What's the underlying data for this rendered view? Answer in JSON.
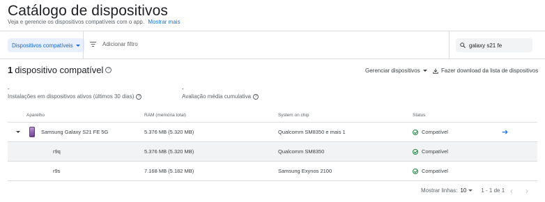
{
  "header": {
    "title": "Catálogo de dispositivos",
    "subtitle": "Veja e gerencie os dispositivos compatíveis com o app.",
    "learn_more": "Mostrar mais"
  },
  "filters": {
    "chip_label": "Dispositivos compatíveis",
    "add_filter": "Adicionar filtro",
    "search_value": "galaxy s21 fe"
  },
  "summary": {
    "count": "1",
    "count_label": "dispositivo compatível",
    "manage": "Gerenciar dispositivos",
    "download": "Fazer download da lista de dispositivos",
    "installs_value": "-",
    "installs_label": "Instalações em dispositivos ativos (últimos 30 dias)",
    "rating_value": "-",
    "rating_label": "Avaliação média cumulativa"
  },
  "table": {
    "columns": [
      "Aparelho",
      "RAM (memória total)",
      "System on chip",
      "Status"
    ],
    "rows": [
      {
        "device": "Samsung Galaxy S21 FE 5G",
        "ram": "5.376 MB (5.320 MB)",
        "soc": "Qualcomm SM8350 e mais 1",
        "status": "Compatível"
      },
      {
        "device": "r9q",
        "ram": "5.376 MB (5.320 MB)",
        "soc": "Qualcomm SM8350",
        "status": "Compatível"
      },
      {
        "device": "r9s",
        "ram": "7.168 MB (5.182 MB)",
        "soc": "Samsung Exynos 2100",
        "status": "Compatível"
      }
    ]
  },
  "pagination": {
    "rows_label": "Mostrar linhas:",
    "rows_value": "10",
    "range": "1 - 1 de 1"
  },
  "icons": {
    "status": "check-circle-icon",
    "open": "arrow-right-icon",
    "search": "search-icon",
    "filter": "filter-icon",
    "download": "download-icon",
    "help": "help-circle-icon"
  },
  "colors": {
    "accent": "#1a73e8",
    "chip_bg": "#e8f0fe",
    "success": "#188038"
  }
}
